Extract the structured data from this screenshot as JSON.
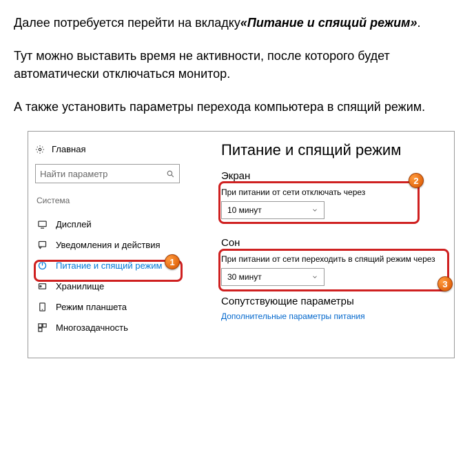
{
  "article": {
    "p1_a": "Далее потребуется перейти на вкладку",
    "p1_b": "«Питание и спящий режим»",
    "p1_c": ".",
    "p2": "Тут можно выставить время не активности, после которого будет автоматически отключаться монитор.",
    "p3": "А также установить параметры перехода компьютера в спящий режим."
  },
  "settings": {
    "home": "Главная",
    "search_placeholder": "Найти параметр",
    "section": "Система",
    "nav": {
      "display": "Дисплей",
      "notifications": "Уведомления и действия",
      "power": "Питание и спящий режим",
      "storage": "Хранилище",
      "tablet": "Режим планшета",
      "multitask": "Многозадачность"
    },
    "content": {
      "title": "Питание и спящий режим",
      "screen_heading": "Экран",
      "screen_label": "При питании от сети отключать через",
      "screen_value": "10 минут",
      "sleep_heading": "Сон",
      "sleep_label": "При питании от сети переходить в спящий режим через",
      "sleep_value": "30 минут",
      "related_heading": "Сопутствующие параметры",
      "related_link": "Дополнительные параметры питания"
    }
  },
  "badges": {
    "b1": "1",
    "b2": "2",
    "b3": "3"
  }
}
